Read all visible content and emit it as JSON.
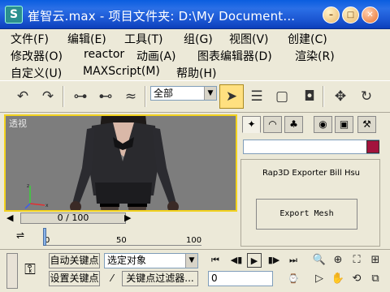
{
  "window": {
    "title": "崔智云.max    - 项目文件夹: D:\\My Document..."
  },
  "menu": {
    "row1": [
      "文件(F)",
      "编辑(E)",
      "工具(T)",
      "组(G)",
      "视图(V)",
      "创建(C)"
    ],
    "row2": [
      "修改器(O)",
      "reactor",
      "动画(A)",
      "图表编辑器(D)",
      "渲染(R)"
    ],
    "row3": [
      "自定义(U)",
      "MAXScript(M)",
      "帮助(H)"
    ]
  },
  "toolbar": {
    "selection_filter": "全部"
  },
  "viewport": {
    "label": "透视"
  },
  "timeline": {
    "frame_counter": "0 / 100",
    "ruler_labels": [
      "0",
      "50",
      "100"
    ]
  },
  "command_panel": {
    "rollout_title": "Rap3D Exporter Bill Hsu",
    "export_button": "Export Mesh",
    "object_color": "#a3133d"
  },
  "bottom": {
    "auto_key": "自动关键点",
    "set_key": "设置关键点",
    "selected_object": "选定对象",
    "key_filters": "关键点过滤器...",
    "current_frame": "0"
  },
  "colors": {
    "titlebar": "#1b56d2",
    "viewport_border": "#f2d21e",
    "viewport_bg": "#7d7d7d"
  }
}
